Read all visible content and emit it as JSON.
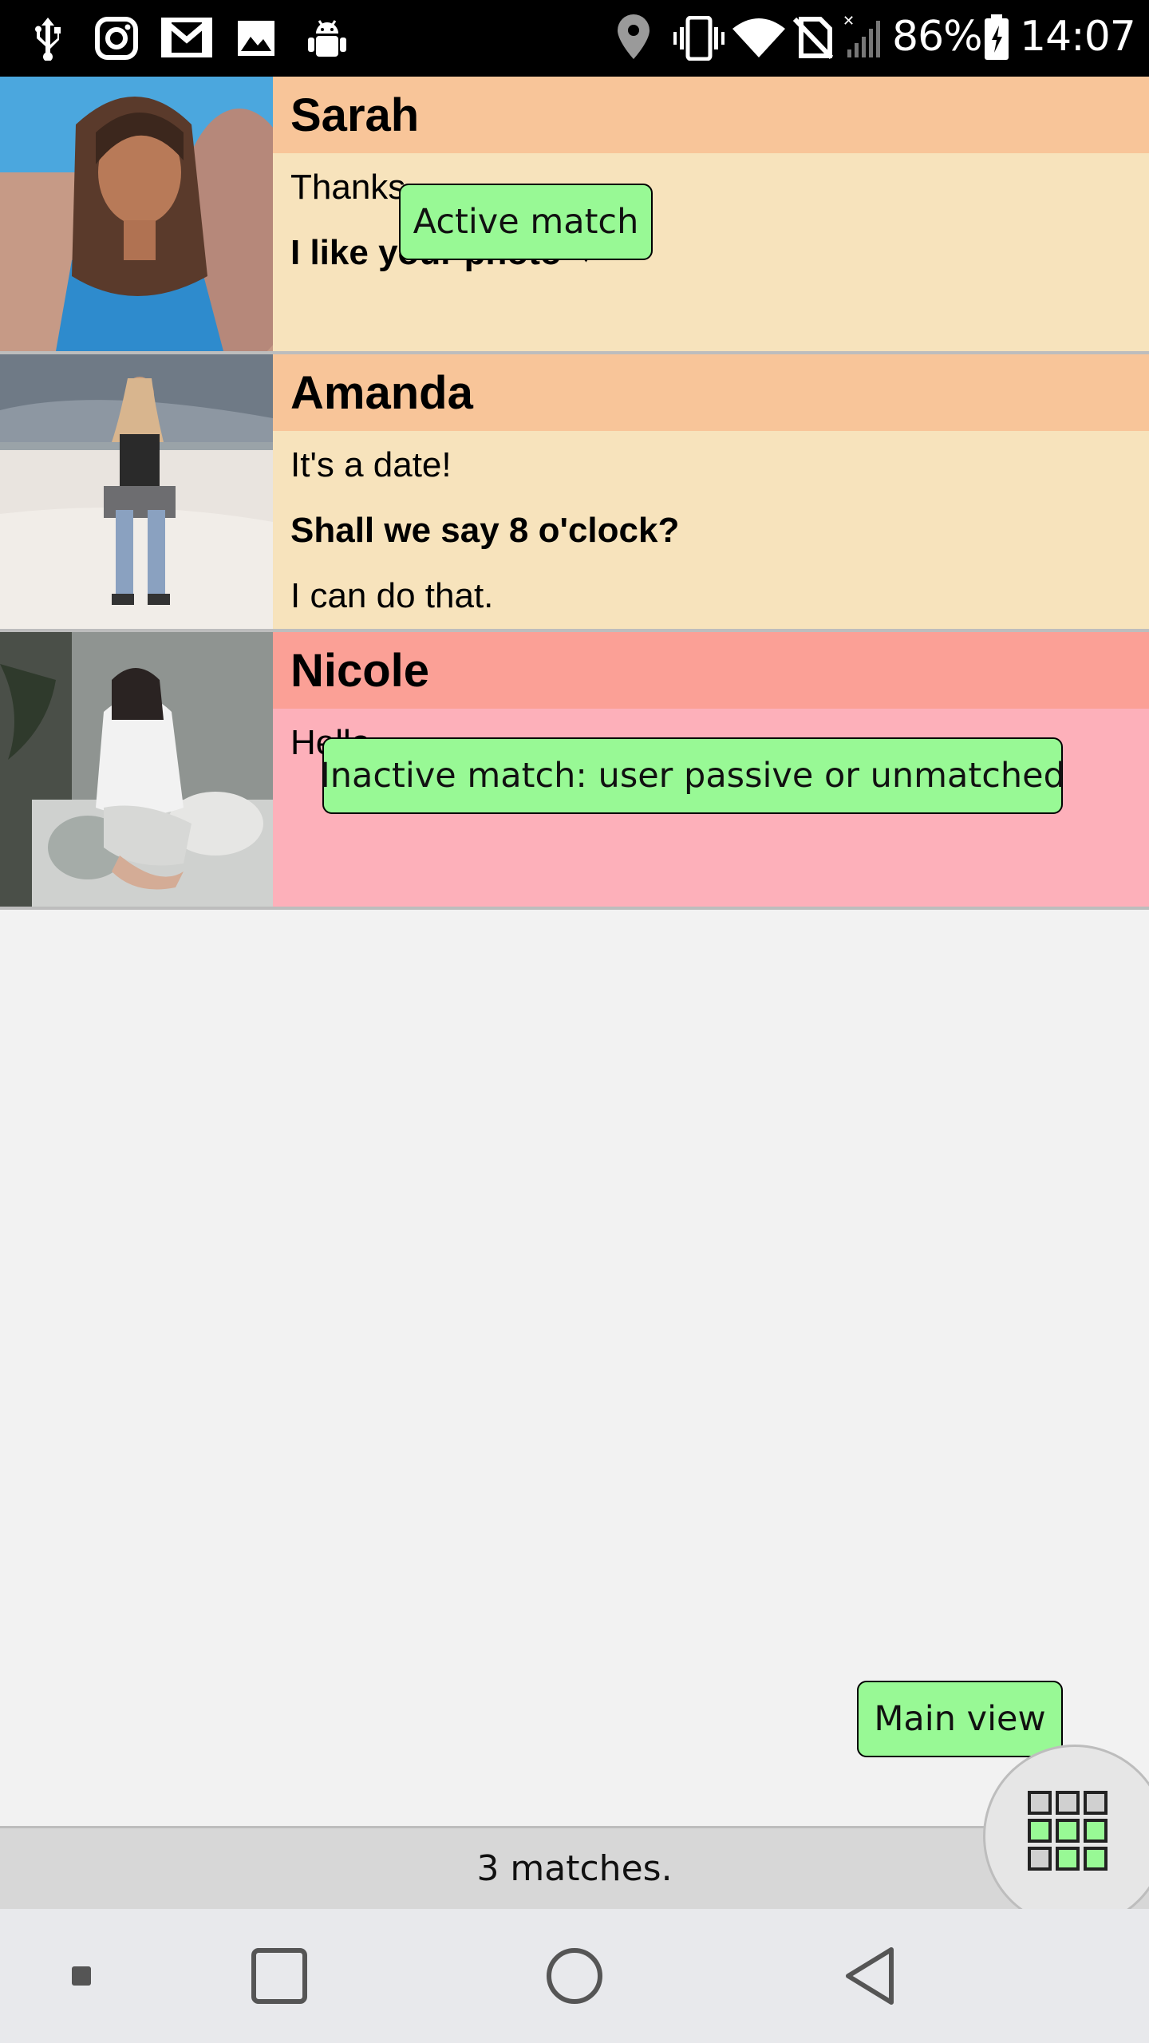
{
  "status_bar": {
    "battery_percent": "86%",
    "time": "14:07",
    "left_icons": [
      "usb-icon",
      "instagram-icon",
      "gmail-icon",
      "image-icon",
      "android-debug-icon"
    ],
    "right_icons": [
      "location-icon",
      "vibrate-icon",
      "wifi-icon",
      "no-sim-icon",
      "signal-icon",
      "battery-icon"
    ]
  },
  "matches": [
    {
      "name": "Sarah",
      "state": "active",
      "messages": [
        {
          "text": "Thanks",
          "bold": false
        },
        {
          "text": "I like your photo ❤",
          "bold": true
        }
      ]
    },
    {
      "name": "Amanda",
      "state": "active",
      "messages": [
        {
          "text": "It's a date!",
          "bold": false
        },
        {
          "text": "Shall we say 8 o'clock?",
          "bold": true
        },
        {
          "text": "I can do that.",
          "bold": false
        }
      ]
    },
    {
      "name": "Nicole",
      "state": "inactive",
      "messages": [
        {
          "text": "Hello",
          "bold": false
        }
      ]
    }
  ],
  "tooltips": {
    "active_match": "Active match",
    "inactive_match": "Inactive match: user passive or unmatched",
    "main_view": "Main view"
  },
  "footer": {
    "match_count": "3 matches."
  },
  "colors": {
    "active_header": "#f8c599",
    "active_body": "#f7e3bc",
    "inactive_header": "#fba096",
    "inactive_body": "#fdb0ba",
    "tooltip_bg": "#98f995",
    "grid_icon_fill": "#98f995"
  },
  "nav_bar": {
    "buttons": [
      "menu-dot-icon",
      "recent-apps-icon",
      "home-icon",
      "back-icon"
    ]
  }
}
